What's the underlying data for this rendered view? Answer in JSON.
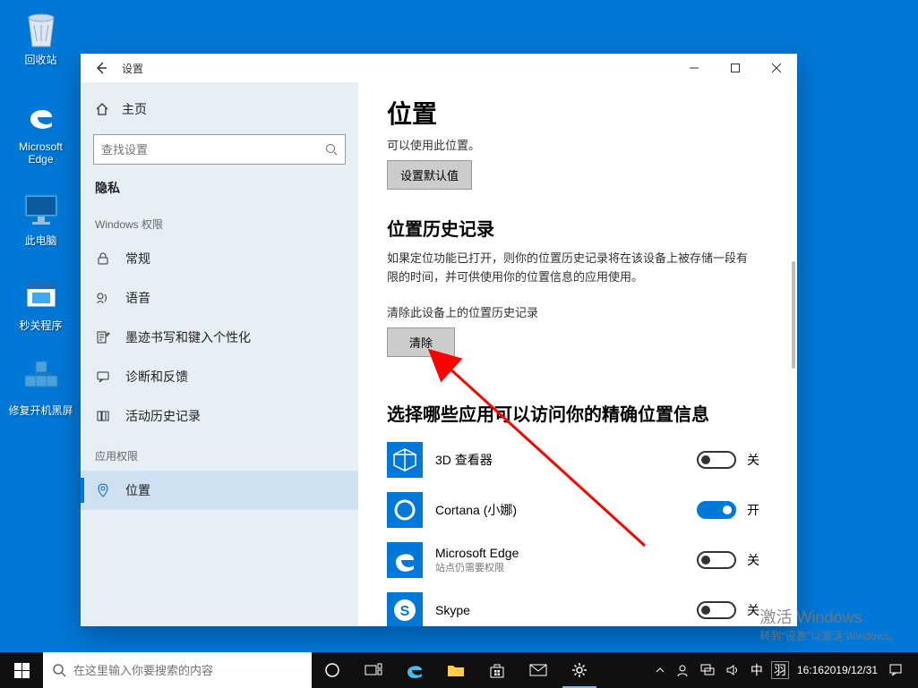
{
  "desktop_icons": {
    "recycle": "回收站",
    "edge": "Microsoft Edge",
    "thispc": "此电脑",
    "app1": "秒关程序",
    "app2": "修复开机黑屏"
  },
  "window": {
    "title": "设置",
    "home": "主页",
    "search_placeholder": "查找设置",
    "section": "隐私",
    "group1": "Windows 权限",
    "nav": {
      "general": "常规",
      "speech": "语音",
      "ink": "墨迹书写和键入个性化",
      "diag": "诊断和反馈",
      "activity": "活动历史记录"
    },
    "group2": "应用权限",
    "nav2": {
      "location": "位置"
    }
  },
  "content": {
    "page_title": "位置",
    "trunc": "可以使用此位置。",
    "set_default": "设置默认值",
    "history_h": "位置历史记录",
    "history_p": "如果定位功能已打开，则你的位置历史记录将在该设备上被存储一段有限的时间，并可供使用你的位置信息的应用使用。",
    "clear_label": "清除此设备上的位置历史记录",
    "clear_btn": "清除",
    "choose_h": "选择哪些应用可以访问你的精确位置信息",
    "apps": {
      "viewer": "3D 查看器",
      "cortana": "Cortana (小娜)",
      "edge": "Microsoft Edge",
      "edge_sub": "站点仍需要权限",
      "skype": "Skype"
    },
    "toggle_on": "开",
    "toggle_off": "关"
  },
  "watermark": {
    "l1": "激活 Windows",
    "l2": "转到\"设置\"以激活 Windows。"
  },
  "taskbar": {
    "search_placeholder": "在这里输入你要搜索的内容",
    "ime1": "中",
    "ime2": "羽",
    "time": "16:16",
    "date": "2019/12/31"
  }
}
